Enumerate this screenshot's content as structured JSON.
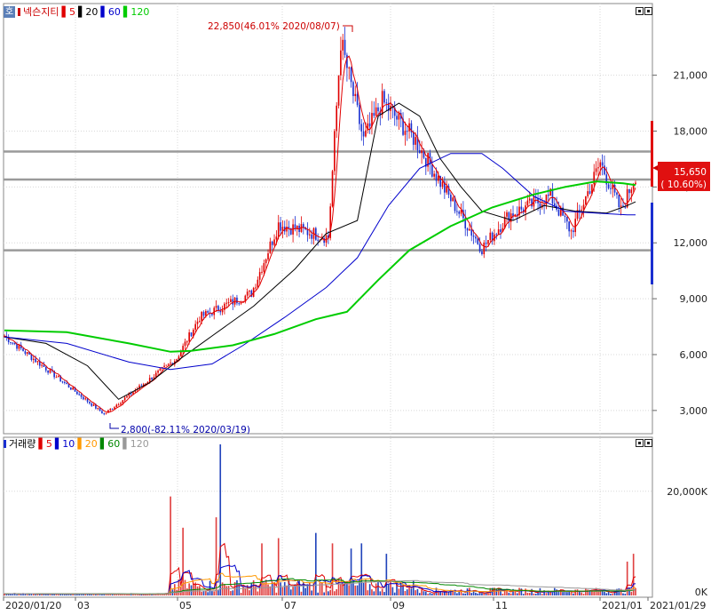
{
  "stock_name": "넥슨지티",
  "price_panel": {
    "legend": [
      {
        "label": "5",
        "color": "#e00000"
      },
      {
        "label": "20",
        "color": "#000000"
      },
      {
        "label": "60",
        "color": "#0000cc"
      },
      {
        "label": "120",
        "color": "#00cc00"
      }
    ],
    "high_annotation": "22,850(46.01% 2020/08/07)",
    "low_annotation": "2,800(-82.11% 2020/03/19)",
    "current_price": "15,650",
    "current_change": "( 10.60%)"
  },
  "volume_panel": {
    "title": "거래량",
    "legend": [
      {
        "label": "5",
        "color": "#e00000"
      },
      {
        "label": "10",
        "color": "#0000cc"
      },
      {
        "label": "20",
        "color": "#ff9900"
      },
      {
        "label": "60",
        "color": "#008800"
      },
      {
        "label": "120",
        "color": "#999999"
      }
    ],
    "axis_labels": [
      "20,000K",
      "0K"
    ]
  },
  "chart_data": {
    "type": "candlestick",
    "y_axis": {
      "ticks": [
        3000,
        6000,
        9000,
        12000,
        15000,
        18000,
        21000
      ],
      "tick_labels": [
        "3,000",
        "6,000",
        "9,000",
        "12,000",
        "15,000",
        "18,000",
        "21,000"
      ],
      "range": [
        1800,
        24800
      ]
    },
    "x_axis": {
      "tick_labels": [
        "2020/01/20",
        "03",
        "05",
        "07",
        "09",
        "11",
        "2021/01",
        "2021/01/29"
      ]
    },
    "horizontal_lines": [
      11600,
      15400,
      16900
    ],
    "key_points": [
      {
        "date": "2020/01/20",
        "price": 7000
      },
      {
        "date": "2020/03/19",
        "price": 2800
      },
      {
        "date": "2020/05/01",
        "price": 5800
      },
      {
        "date": "2020/05/15",
        "price": 8000
      },
      {
        "date": "2020/06/15",
        "price": 9300
      },
      {
        "date": "2020/07/01",
        "price": 13000
      },
      {
        "date": "2020/07/31",
        "price": 12300
      },
      {
        "date": "2020/08/07",
        "price": 22850
      },
      {
        "date": "2020/08/20",
        "price": 17500
      },
      {
        "date": "2020/09/01",
        "price": 19600
      },
      {
        "date": "2020/09/20",
        "price": 17500
      },
      {
        "date": "2020/10/10",
        "price": 14500
      },
      {
        "date": "2020/10/30",
        "price": 11700
      },
      {
        "date": "2020/11/15",
        "price": 13500
      },
      {
        "date": "2020/12/10",
        "price": 14500
      },
      {
        "date": "2020/12/22",
        "price": 12600
      },
      {
        "date": "2021/01/08",
        "price": 16300
      },
      {
        "date": "2021/01/20",
        "price": 13700
      },
      {
        "date": "2021/01/29",
        "price": 15650
      }
    ],
    "moving_averages": [
      {
        "name": "5",
        "color": "#e00000"
      },
      {
        "name": "20",
        "color": "#000000",
        "points": [
          [
            0,
            6950
          ],
          [
            20,
            6600
          ],
          [
            40,
            5400
          ],
          [
            55,
            3600
          ],
          [
            70,
            4500
          ],
          [
            85,
            5800
          ],
          [
            100,
            7000
          ],
          [
            120,
            8600
          ],
          [
            140,
            10600
          ],
          [
            155,
            12500
          ],
          [
            170,
            13200
          ],
          [
            180,
            18800
          ],
          [
            190,
            19500
          ],
          [
            200,
            18800
          ],
          [
            210,
            16500
          ],
          [
            220,
            15000
          ],
          [
            230,
            13700
          ],
          [
            245,
            13200
          ],
          [
            260,
            14000
          ],
          [
            275,
            13700
          ],
          [
            290,
            13600
          ],
          [
            300,
            14000
          ],
          [
            304,
            14200
          ]
        ]
      },
      {
        "name": "60",
        "color": "#0000cc",
        "points": [
          [
            0,
            6950
          ],
          [
            30,
            6600
          ],
          [
            60,
            5600
          ],
          [
            80,
            5200
          ],
          [
            100,
            5500
          ],
          [
            115,
            6500
          ],
          [
            135,
            8000
          ],
          [
            155,
            9600
          ],
          [
            170,
            11200
          ],
          [
            185,
            14000
          ],
          [
            200,
            16000
          ],
          [
            215,
            16800
          ],
          [
            230,
            16800
          ],
          [
            240,
            16000
          ],
          [
            255,
            14500
          ],
          [
            270,
            13700
          ],
          [
            285,
            13600
          ],
          [
            300,
            13500
          ],
          [
            304,
            13500
          ]
        ]
      },
      {
        "name": "120",
        "color": "#00cc00",
        "points": [
          [
            0,
            7300
          ],
          [
            30,
            7200
          ],
          [
            60,
            6600
          ],
          [
            80,
            6150
          ],
          [
            90,
            6200
          ],
          [
            110,
            6500
          ],
          [
            130,
            7100
          ],
          [
            150,
            7900
          ],
          [
            165,
            8300
          ],
          [
            180,
            10000
          ],
          [
            195,
            11600
          ],
          [
            215,
            12900
          ],
          [
            235,
            13900
          ],
          [
            255,
            14600
          ],
          [
            270,
            15000
          ],
          [
            285,
            15300
          ],
          [
            298,
            15200
          ],
          [
            304,
            15100
          ]
        ]
      }
    ],
    "volume_k": {
      "max": 29000,
      "spikes": [
        [
          80,
          19000
        ],
        [
          86,
          13000
        ],
        [
          102,
          15000
        ],
        [
          104,
          29000
        ],
        [
          124,
          10000
        ],
        [
          132,
          11000
        ],
        [
          150,
          12000
        ],
        [
          158,
          10000
        ],
        [
          167,
          9000
        ],
        [
          172,
          10000
        ],
        [
          184,
          8000
        ],
        [
          300,
          6500
        ],
        [
          303,
          8000
        ]
      ]
    }
  }
}
